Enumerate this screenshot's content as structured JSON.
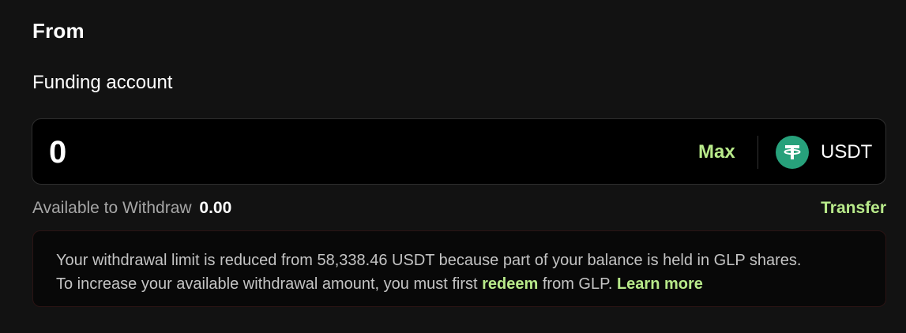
{
  "section": {
    "title": "From"
  },
  "account": {
    "label": "Funding account"
  },
  "amount": {
    "value": "0",
    "max_label": "Max"
  },
  "currency": {
    "symbol": "USDT",
    "icon": "tether-icon",
    "icon_color": "#27a17b"
  },
  "available": {
    "label": "Available to Withdraw",
    "value": "0.00"
  },
  "transfer": {
    "label": "Transfer"
  },
  "notice": {
    "line1": "Your withdrawal limit is reduced from 58,338.46 USDT because part of your balance is held in GLP shares.",
    "line2_before": "To increase your available withdrawal amount, you must first ",
    "redeem_label": "redeem",
    "line2_middle": " from GLP. ",
    "learn_more_label": "Learn more"
  },
  "colors": {
    "accent": "#b8ea8a",
    "background": "#121212",
    "input_background": "#000000"
  }
}
